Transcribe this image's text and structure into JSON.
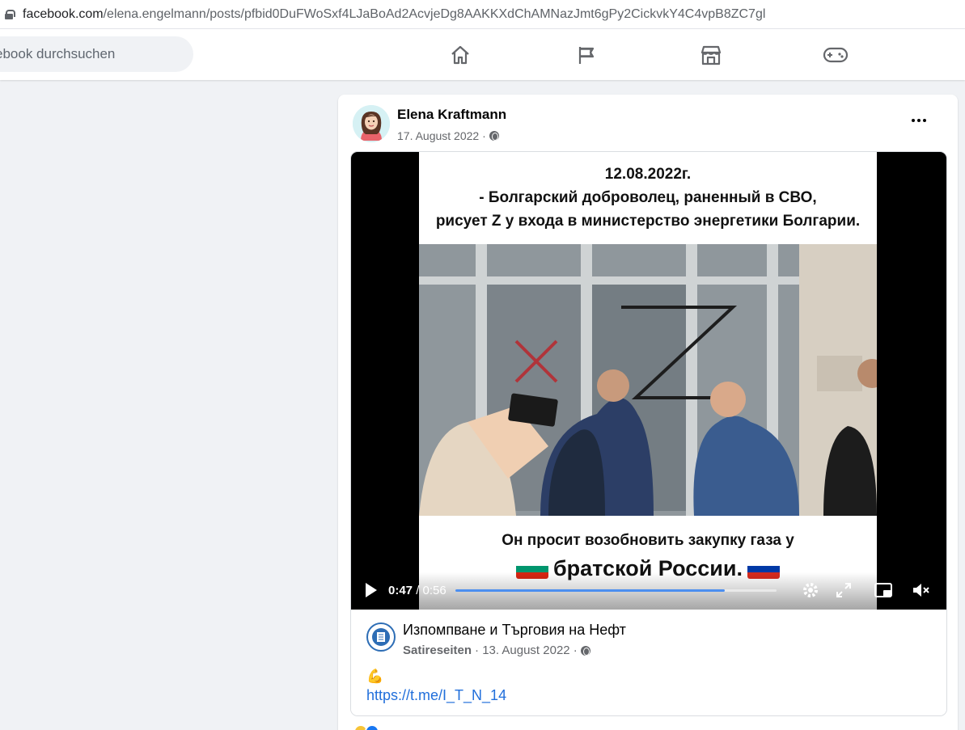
{
  "browser": {
    "url_host": "facebook.com",
    "url_path": "/elena.engelmann/posts/pfbid0DuFWoSxf4LJaBoAd2AcvjeDg8AAKKXdChAMNazJmt6gPy2CickvkY4C4vpB8ZC7gl"
  },
  "nav": {
    "search_placeholder": "ebook durchsuchen",
    "icons": [
      "home-icon",
      "flag-icon",
      "marketplace-icon",
      "gaming-icon"
    ]
  },
  "post": {
    "author": "Elena Kraftmann",
    "date": "17. August 2022 ·",
    "privacy_icon": "globe-icon"
  },
  "video": {
    "caption_line1": "12.08.2022г.",
    "caption_line2": "- Болгарский доброволец, раненный в СВО,",
    "caption_line3": "рисует Z у входа в министерство энергетики Болгарии.",
    "caption_bottom1": "Он просит возобновить закупку газа у",
    "caption_bottom2": "братской России.",
    "current_time": "0:47",
    "duration": "/ 0:56",
    "progress": 0.84
  },
  "shared_page": {
    "name": "Изпомпване и Търговия на Нефт",
    "source": "Satireseiten",
    "date": "· 13. August 2022 ·",
    "emoji": "💪",
    "link": "https://t.me/I_T_N_14"
  },
  "colors": {
    "accent": "#216fdb",
    "progress": "#4c8ff0",
    "background": "#f0f2f5"
  }
}
